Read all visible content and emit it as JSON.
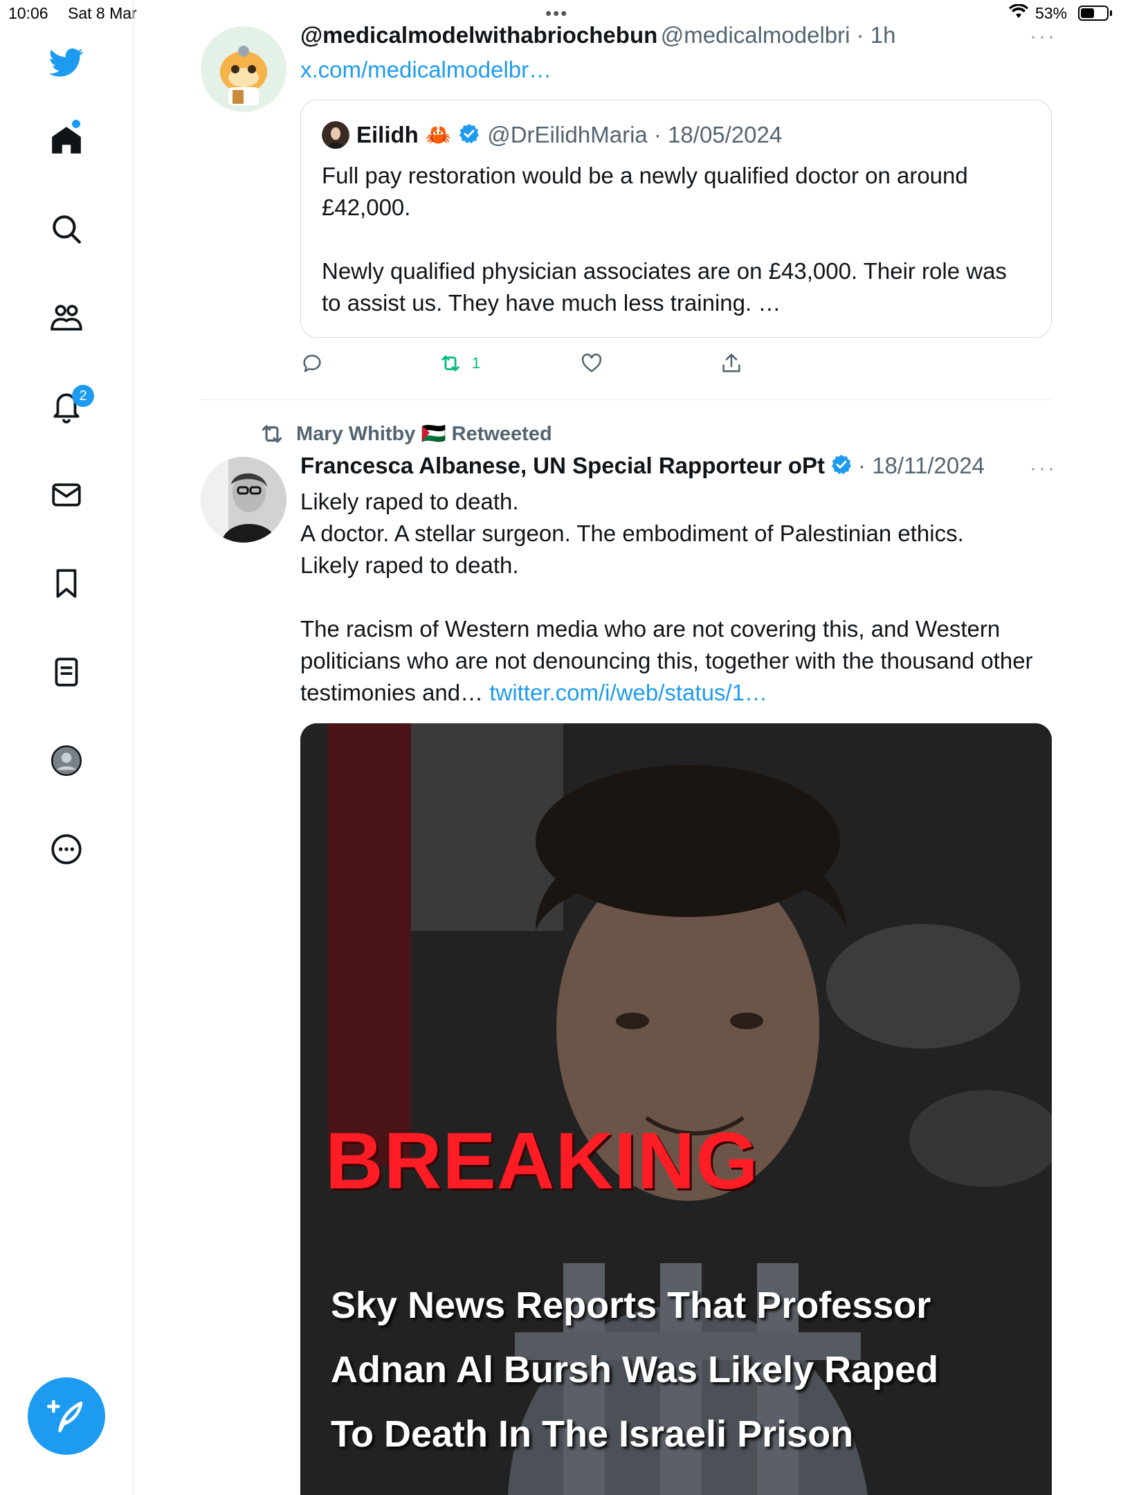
{
  "status_bar": {
    "time": "10:06",
    "date": "Sat 8 Mar",
    "battery": "53%",
    "battery_level": 0.53
  },
  "sidebar": {
    "notifications_count": "2",
    "items": [
      "twitter-logo",
      "home",
      "explore",
      "communities",
      "notifications",
      "messages",
      "bookmarks",
      "lists",
      "profile",
      "more"
    ]
  },
  "tweet1": {
    "display_name": "@medicalmodelwithabriochebun",
    "meta": "@medicalmodelbri · 1h",
    "link": "x.com/medicalmodelbr…",
    "quote": {
      "name": "Eilidh",
      "emoji": "🦀",
      "meta": "@DrEilidhMaria · 18/05/2024",
      "text": "Full pay restoration would be a newly qualified doctor on around £42,000.\n\nNewly qualified physician associates are on £43,000. Their role was to assist us. They have much less training. …"
    },
    "retweet_count": "1"
  },
  "tweet2": {
    "retweeted_by": "Mary Whitby 🇵🇸 Retweeted",
    "display_name": "Francesca Albanese, UN Special Rapporteur oPt",
    "meta": "· 18/11/2024",
    "text": "Likely raped to death.\nA doctor. A stellar surgeon. The embodiment of Palestinian ethics.\nLikely raped to death.\n\nThe racism of Western media who are not covering this, and Western politicians who are not denouncing this, together with the thousand other testimonies and… ",
    "link": "twitter.com/i/web/status/1…",
    "media": {
      "headline": "BREAKING",
      "lines": [
        "Sky News Reports That Professor",
        "Adnan Al Bursh Was Likely Raped",
        "To Death In The Israeli Prison"
      ]
    }
  },
  "colors": {
    "accent": "#1d9bf0",
    "retweet_green": "#00ba7c",
    "breaking_red": "#ff1d25"
  }
}
